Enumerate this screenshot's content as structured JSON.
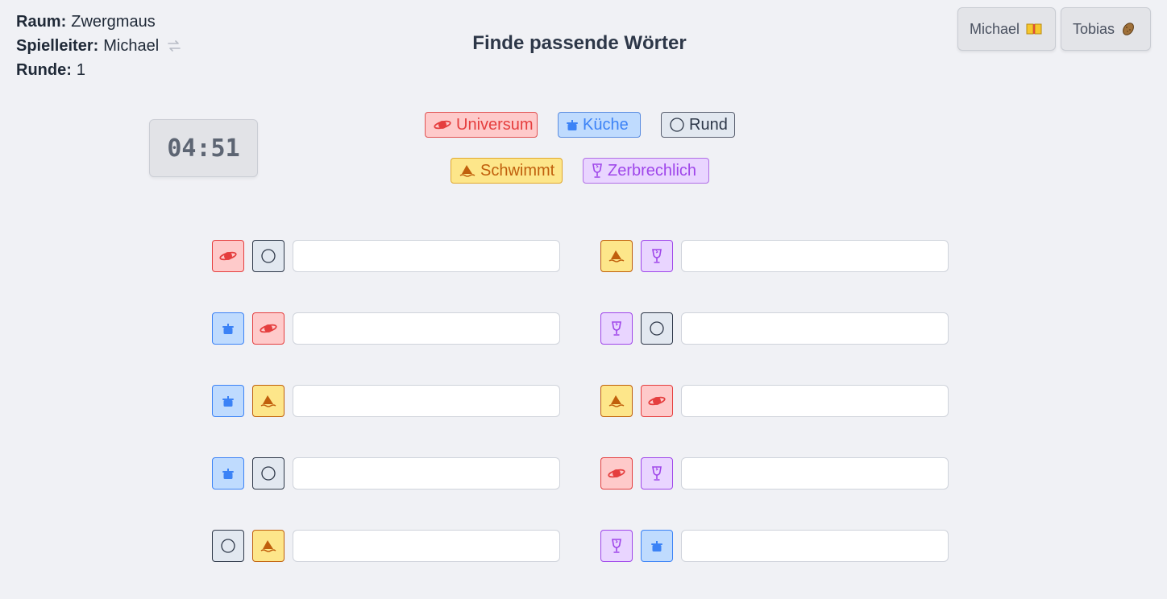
{
  "room": {
    "label": "Raum:",
    "value": "Zwergmaus"
  },
  "leader": {
    "label": "Spielleiter:",
    "value": "Michael"
  },
  "round": {
    "label": "Runde:",
    "value": "1"
  },
  "title": "Finde passende Wörter",
  "players": [
    {
      "name": "Michael",
      "icon": "book-icon"
    },
    {
      "name": "Tobias",
      "icon": "potato-icon"
    }
  ],
  "timer": "04:51",
  "categories": [
    {
      "key": "universe",
      "label": "Universum",
      "icon": "planet-icon",
      "color": "#e53e3e"
    },
    {
      "key": "kitchen",
      "label": "Küche",
      "icon": "pot-icon",
      "color": "#3b82f6"
    },
    {
      "key": "round",
      "label": "Rund",
      "icon": "circle-icon",
      "color": "#2d3748"
    },
    {
      "key": "swim",
      "label": "Schwimmt",
      "icon": "sailboat-icon",
      "color": "#c05f0c"
    },
    {
      "key": "fragile",
      "label": "Zerbrechlich",
      "icon": "wine-glass-icon",
      "color": "#9f46ea"
    }
  ],
  "pairs": [
    {
      "a": "universe",
      "b": "round",
      "value": ""
    },
    {
      "a": "kitchen",
      "b": "universe",
      "value": ""
    },
    {
      "a": "kitchen",
      "b": "swim",
      "value": ""
    },
    {
      "a": "kitchen",
      "b": "round",
      "value": ""
    },
    {
      "a": "round",
      "b": "swim",
      "value": ""
    },
    {
      "a": "swim",
      "b": "fragile",
      "value": ""
    },
    {
      "a": "fragile",
      "b": "round",
      "value": ""
    },
    {
      "a": "swim",
      "b": "universe",
      "value": ""
    },
    {
      "a": "universe",
      "b": "fragile",
      "value": ""
    },
    {
      "a": "fragile",
      "b": "kitchen",
      "value": ""
    }
  ]
}
